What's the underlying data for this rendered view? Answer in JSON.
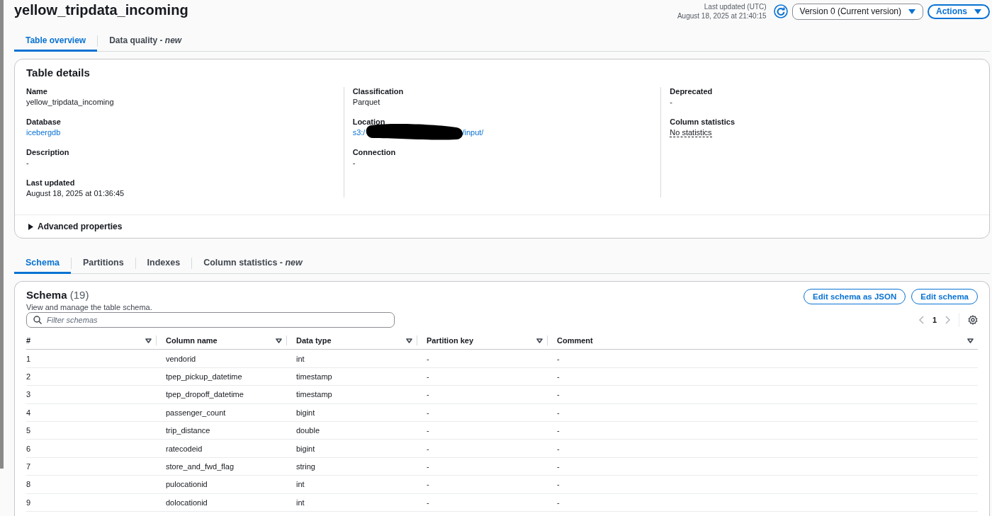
{
  "header": {
    "title": "yellow_tripdata_incoming",
    "last_updated_label": "Last updated (UTC)",
    "last_updated_value": "August 18, 2025 at 21:40:15",
    "version_select": "Version 0 (Current version)",
    "actions_button": "Actions"
  },
  "top_tabs": [
    {
      "label": "Table overview",
      "selected": true
    },
    {
      "label": "Data quality - *new*",
      "selected": false
    }
  ],
  "table_details": {
    "title": "Table details",
    "columns": [
      [
        {
          "label": "Name",
          "value": "yellow_tripdata_incoming",
          "kind": "text"
        },
        {
          "label": "Database",
          "value": "icebergdb",
          "kind": "link"
        },
        {
          "label": "Description",
          "value": "-",
          "kind": "text"
        },
        {
          "label": "Last updated",
          "value": "August 18, 2025 at 01:36:45",
          "kind": "text"
        }
      ],
      [
        {
          "label": "Classification",
          "value": "Parquet",
          "kind": "text"
        },
        {
          "label": "Location",
          "kind": "redacted_link",
          "prefix": "s3:/",
          "suffix": "/input/",
          "redacted": true
        },
        {
          "label": "Connection",
          "value": "-",
          "kind": "text"
        }
      ],
      [
        {
          "label": "Deprecated",
          "value": "-",
          "kind": "text"
        },
        {
          "label": "Column statistics",
          "value": "No statistics",
          "kind": "dotted"
        }
      ]
    ],
    "advanced": {
      "label": "Advanced properties",
      "expanded": false
    }
  },
  "schema_tabs": [
    {
      "label": "Schema",
      "selected": true
    },
    {
      "label": "Partitions",
      "selected": false
    },
    {
      "label": "Indexes",
      "selected": false
    },
    {
      "label": "Column statistics - *new*",
      "selected": false
    }
  ],
  "schema": {
    "title": "Schema",
    "count": "(19)",
    "description": "View and manage the table schema.",
    "buttons": [
      "Edit schema as JSON",
      "Edit schema"
    ],
    "filter": {
      "placeholder": "Filter schemas"
    },
    "page": "1",
    "columns": [
      "#",
      "Column name",
      "Data type",
      "Partition key",
      "Comment"
    ],
    "rows": [
      [
        "1",
        "vendorid",
        "int",
        "-",
        "-"
      ],
      [
        "2",
        "tpep_pickup_datetime",
        "timestamp",
        "-",
        "-"
      ],
      [
        "3",
        "tpep_dropoff_datetime",
        "timestamp",
        "-",
        "-"
      ],
      [
        "4",
        "passenger_count",
        "bigint",
        "-",
        "-"
      ],
      [
        "5",
        "trip_distance",
        "double",
        "-",
        "-"
      ],
      [
        "6",
        "ratecodeid",
        "bigint",
        "-",
        "-"
      ],
      [
        "7",
        "store_and_fwd_flag",
        "string",
        "-",
        "-"
      ],
      [
        "8",
        "pulocationid",
        "int",
        "-",
        "-"
      ],
      [
        "9",
        "dolocationid",
        "int",
        "-",
        "-"
      ]
    ]
  }
}
